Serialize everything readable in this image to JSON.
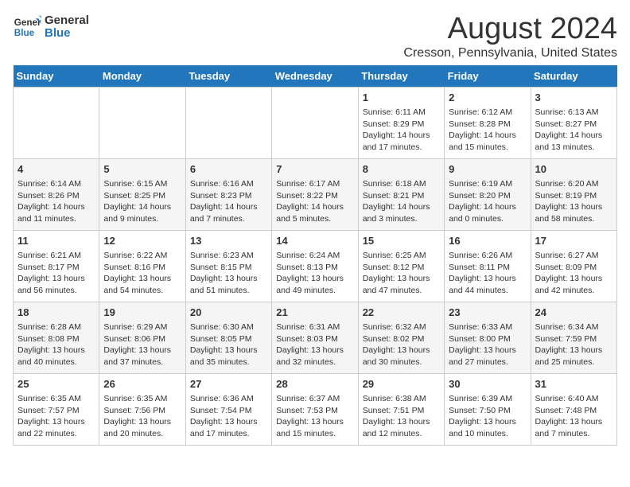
{
  "logo": {
    "line1": "General",
    "line2": "Blue"
  },
  "title": "August 2024",
  "subtitle": "Cresson, Pennsylvania, United States",
  "days_of_week": [
    "Sunday",
    "Monday",
    "Tuesday",
    "Wednesday",
    "Thursday",
    "Friday",
    "Saturday"
  ],
  "weeks": [
    [
      {
        "day": "",
        "content": ""
      },
      {
        "day": "",
        "content": ""
      },
      {
        "day": "",
        "content": ""
      },
      {
        "day": "",
        "content": ""
      },
      {
        "day": "1",
        "content": "Sunrise: 6:11 AM\nSunset: 8:29 PM\nDaylight: 14 hours and 17 minutes."
      },
      {
        "day": "2",
        "content": "Sunrise: 6:12 AM\nSunset: 8:28 PM\nDaylight: 14 hours and 15 minutes."
      },
      {
        "day": "3",
        "content": "Sunrise: 6:13 AM\nSunset: 8:27 PM\nDaylight: 14 hours and 13 minutes."
      }
    ],
    [
      {
        "day": "4",
        "content": "Sunrise: 6:14 AM\nSunset: 8:26 PM\nDaylight: 14 hours and 11 minutes."
      },
      {
        "day": "5",
        "content": "Sunrise: 6:15 AM\nSunset: 8:25 PM\nDaylight: 14 hours and 9 minutes."
      },
      {
        "day": "6",
        "content": "Sunrise: 6:16 AM\nSunset: 8:23 PM\nDaylight: 14 hours and 7 minutes."
      },
      {
        "day": "7",
        "content": "Sunrise: 6:17 AM\nSunset: 8:22 PM\nDaylight: 14 hours and 5 minutes."
      },
      {
        "day": "8",
        "content": "Sunrise: 6:18 AM\nSunset: 8:21 PM\nDaylight: 14 hours and 3 minutes."
      },
      {
        "day": "9",
        "content": "Sunrise: 6:19 AM\nSunset: 8:20 PM\nDaylight: 14 hours and 0 minutes."
      },
      {
        "day": "10",
        "content": "Sunrise: 6:20 AM\nSunset: 8:19 PM\nDaylight: 13 hours and 58 minutes."
      }
    ],
    [
      {
        "day": "11",
        "content": "Sunrise: 6:21 AM\nSunset: 8:17 PM\nDaylight: 13 hours and 56 minutes."
      },
      {
        "day": "12",
        "content": "Sunrise: 6:22 AM\nSunset: 8:16 PM\nDaylight: 13 hours and 54 minutes."
      },
      {
        "day": "13",
        "content": "Sunrise: 6:23 AM\nSunset: 8:15 PM\nDaylight: 13 hours and 51 minutes."
      },
      {
        "day": "14",
        "content": "Sunrise: 6:24 AM\nSunset: 8:13 PM\nDaylight: 13 hours and 49 minutes."
      },
      {
        "day": "15",
        "content": "Sunrise: 6:25 AM\nSunset: 8:12 PM\nDaylight: 13 hours and 47 minutes."
      },
      {
        "day": "16",
        "content": "Sunrise: 6:26 AM\nSunset: 8:11 PM\nDaylight: 13 hours and 44 minutes."
      },
      {
        "day": "17",
        "content": "Sunrise: 6:27 AM\nSunset: 8:09 PM\nDaylight: 13 hours and 42 minutes."
      }
    ],
    [
      {
        "day": "18",
        "content": "Sunrise: 6:28 AM\nSunset: 8:08 PM\nDaylight: 13 hours and 40 minutes."
      },
      {
        "day": "19",
        "content": "Sunrise: 6:29 AM\nSunset: 8:06 PM\nDaylight: 13 hours and 37 minutes."
      },
      {
        "day": "20",
        "content": "Sunrise: 6:30 AM\nSunset: 8:05 PM\nDaylight: 13 hours and 35 minutes."
      },
      {
        "day": "21",
        "content": "Sunrise: 6:31 AM\nSunset: 8:03 PM\nDaylight: 13 hours and 32 minutes."
      },
      {
        "day": "22",
        "content": "Sunrise: 6:32 AM\nSunset: 8:02 PM\nDaylight: 13 hours and 30 minutes."
      },
      {
        "day": "23",
        "content": "Sunrise: 6:33 AM\nSunset: 8:00 PM\nDaylight: 13 hours and 27 minutes."
      },
      {
        "day": "24",
        "content": "Sunrise: 6:34 AM\nSunset: 7:59 PM\nDaylight: 13 hours and 25 minutes."
      }
    ],
    [
      {
        "day": "25",
        "content": "Sunrise: 6:35 AM\nSunset: 7:57 PM\nDaylight: 13 hours and 22 minutes."
      },
      {
        "day": "26",
        "content": "Sunrise: 6:35 AM\nSunset: 7:56 PM\nDaylight: 13 hours and 20 minutes."
      },
      {
        "day": "27",
        "content": "Sunrise: 6:36 AM\nSunset: 7:54 PM\nDaylight: 13 hours and 17 minutes."
      },
      {
        "day": "28",
        "content": "Sunrise: 6:37 AM\nSunset: 7:53 PM\nDaylight: 13 hours and 15 minutes."
      },
      {
        "day": "29",
        "content": "Sunrise: 6:38 AM\nSunset: 7:51 PM\nDaylight: 13 hours and 12 minutes."
      },
      {
        "day": "30",
        "content": "Sunrise: 6:39 AM\nSunset: 7:50 PM\nDaylight: 13 hours and 10 minutes."
      },
      {
        "day": "31",
        "content": "Sunrise: 6:40 AM\nSunset: 7:48 PM\nDaylight: 13 hours and 7 minutes."
      }
    ]
  ]
}
